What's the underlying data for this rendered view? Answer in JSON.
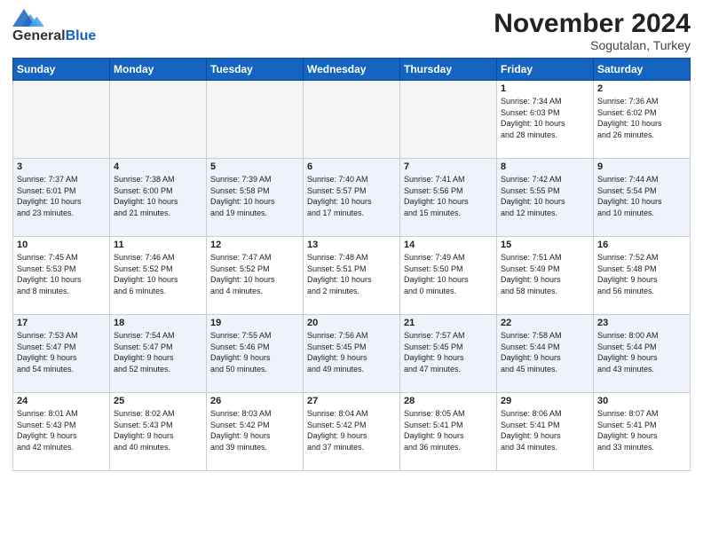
{
  "header": {
    "logo_general": "General",
    "logo_blue": "Blue",
    "month": "November 2024",
    "location": "Sogutalan, Turkey"
  },
  "weekdays": [
    "Sunday",
    "Monday",
    "Tuesday",
    "Wednesday",
    "Thursday",
    "Friday",
    "Saturday"
  ],
  "weeks": [
    [
      {
        "day": "",
        "info": ""
      },
      {
        "day": "",
        "info": ""
      },
      {
        "day": "",
        "info": ""
      },
      {
        "day": "",
        "info": ""
      },
      {
        "day": "",
        "info": ""
      },
      {
        "day": "1",
        "info": "Sunrise: 7:34 AM\nSunset: 6:03 PM\nDaylight: 10 hours\nand 28 minutes."
      },
      {
        "day": "2",
        "info": "Sunrise: 7:36 AM\nSunset: 6:02 PM\nDaylight: 10 hours\nand 26 minutes."
      }
    ],
    [
      {
        "day": "3",
        "info": "Sunrise: 7:37 AM\nSunset: 6:01 PM\nDaylight: 10 hours\nand 23 minutes."
      },
      {
        "day": "4",
        "info": "Sunrise: 7:38 AM\nSunset: 6:00 PM\nDaylight: 10 hours\nand 21 minutes."
      },
      {
        "day": "5",
        "info": "Sunrise: 7:39 AM\nSunset: 5:58 PM\nDaylight: 10 hours\nand 19 minutes."
      },
      {
        "day": "6",
        "info": "Sunrise: 7:40 AM\nSunset: 5:57 PM\nDaylight: 10 hours\nand 17 minutes."
      },
      {
        "day": "7",
        "info": "Sunrise: 7:41 AM\nSunset: 5:56 PM\nDaylight: 10 hours\nand 15 minutes."
      },
      {
        "day": "8",
        "info": "Sunrise: 7:42 AM\nSunset: 5:55 PM\nDaylight: 10 hours\nand 12 minutes."
      },
      {
        "day": "9",
        "info": "Sunrise: 7:44 AM\nSunset: 5:54 PM\nDaylight: 10 hours\nand 10 minutes."
      }
    ],
    [
      {
        "day": "10",
        "info": "Sunrise: 7:45 AM\nSunset: 5:53 PM\nDaylight: 10 hours\nand 8 minutes."
      },
      {
        "day": "11",
        "info": "Sunrise: 7:46 AM\nSunset: 5:52 PM\nDaylight: 10 hours\nand 6 minutes."
      },
      {
        "day": "12",
        "info": "Sunrise: 7:47 AM\nSunset: 5:52 PM\nDaylight: 10 hours\nand 4 minutes."
      },
      {
        "day": "13",
        "info": "Sunrise: 7:48 AM\nSunset: 5:51 PM\nDaylight: 10 hours\nand 2 minutes."
      },
      {
        "day": "14",
        "info": "Sunrise: 7:49 AM\nSunset: 5:50 PM\nDaylight: 10 hours\nand 0 minutes."
      },
      {
        "day": "15",
        "info": "Sunrise: 7:51 AM\nSunset: 5:49 PM\nDaylight: 9 hours\nand 58 minutes."
      },
      {
        "day": "16",
        "info": "Sunrise: 7:52 AM\nSunset: 5:48 PM\nDaylight: 9 hours\nand 56 minutes."
      }
    ],
    [
      {
        "day": "17",
        "info": "Sunrise: 7:53 AM\nSunset: 5:47 PM\nDaylight: 9 hours\nand 54 minutes."
      },
      {
        "day": "18",
        "info": "Sunrise: 7:54 AM\nSunset: 5:47 PM\nDaylight: 9 hours\nand 52 minutes."
      },
      {
        "day": "19",
        "info": "Sunrise: 7:55 AM\nSunset: 5:46 PM\nDaylight: 9 hours\nand 50 minutes."
      },
      {
        "day": "20",
        "info": "Sunrise: 7:56 AM\nSunset: 5:45 PM\nDaylight: 9 hours\nand 49 minutes."
      },
      {
        "day": "21",
        "info": "Sunrise: 7:57 AM\nSunset: 5:45 PM\nDaylight: 9 hours\nand 47 minutes."
      },
      {
        "day": "22",
        "info": "Sunrise: 7:58 AM\nSunset: 5:44 PM\nDaylight: 9 hours\nand 45 minutes."
      },
      {
        "day": "23",
        "info": "Sunrise: 8:00 AM\nSunset: 5:44 PM\nDaylight: 9 hours\nand 43 minutes."
      }
    ],
    [
      {
        "day": "24",
        "info": "Sunrise: 8:01 AM\nSunset: 5:43 PM\nDaylight: 9 hours\nand 42 minutes."
      },
      {
        "day": "25",
        "info": "Sunrise: 8:02 AM\nSunset: 5:43 PM\nDaylight: 9 hours\nand 40 minutes."
      },
      {
        "day": "26",
        "info": "Sunrise: 8:03 AM\nSunset: 5:42 PM\nDaylight: 9 hours\nand 39 minutes."
      },
      {
        "day": "27",
        "info": "Sunrise: 8:04 AM\nSunset: 5:42 PM\nDaylight: 9 hours\nand 37 minutes."
      },
      {
        "day": "28",
        "info": "Sunrise: 8:05 AM\nSunset: 5:41 PM\nDaylight: 9 hours\nand 36 minutes."
      },
      {
        "day": "29",
        "info": "Sunrise: 8:06 AM\nSunset: 5:41 PM\nDaylight: 9 hours\nand 34 minutes."
      },
      {
        "day": "30",
        "info": "Sunrise: 8:07 AM\nSunset: 5:41 PM\nDaylight: 9 hours\nand 33 minutes."
      }
    ]
  ]
}
